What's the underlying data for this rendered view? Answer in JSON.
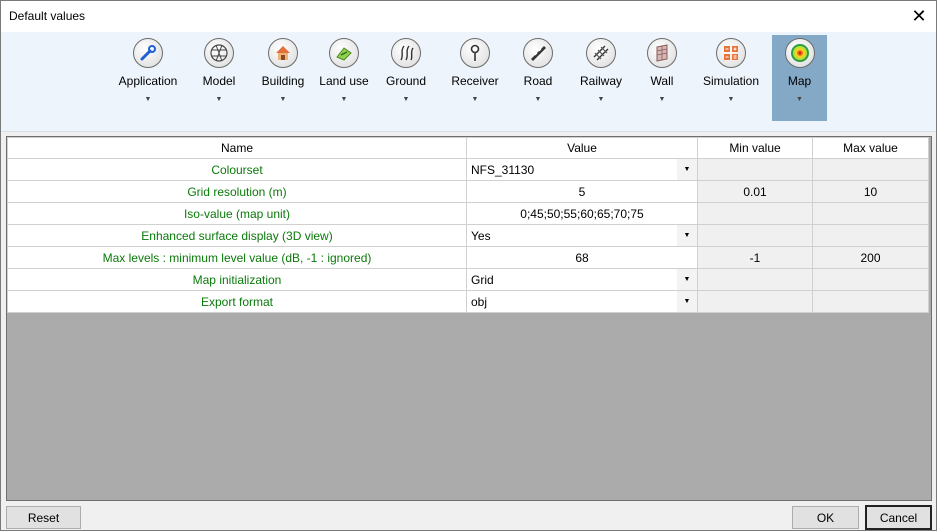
{
  "window": {
    "title": "Default values",
    "close_glyph": "✕"
  },
  "ribbon": {
    "tools": [
      {
        "label": "Application",
        "icon": "wrench-icon",
        "active": false
      },
      {
        "label": "Model",
        "icon": "mesh-icon",
        "active": false
      },
      {
        "label": "Building",
        "icon": "house-icon",
        "active": false
      },
      {
        "label": "Land use",
        "icon": "land-use-icon",
        "active": false
      },
      {
        "label": "Ground",
        "icon": "ground-icon",
        "active": false
      },
      {
        "label": "Receiver",
        "icon": "receiver-icon",
        "active": false
      },
      {
        "label": "Road",
        "icon": "road-icon",
        "active": false
      },
      {
        "label": "Railway",
        "icon": "railway-icon",
        "active": false
      },
      {
        "label": "Wall",
        "icon": "wall-icon",
        "active": false
      },
      {
        "label": "Simulation",
        "icon": "calculator-icon",
        "active": false
      },
      {
        "label": "Map",
        "icon": "map-icon",
        "active": true
      }
    ],
    "dropdown_glyph": "▼"
  },
  "table": {
    "headers": {
      "name": "Name",
      "value": "Value",
      "min": "Min value",
      "max": "Max value"
    },
    "rows": [
      {
        "name": "Colourset",
        "value": "NFS_31130",
        "combo": true,
        "min": "",
        "max": ""
      },
      {
        "name": "Grid resolution (m)",
        "value": "5",
        "combo": false,
        "min": "0.01",
        "max": "10"
      },
      {
        "name": "Iso-value (map unit)",
        "value": "0;45;50;55;60;65;70;75",
        "combo": false,
        "min": "",
        "max": ""
      },
      {
        "name": "Enhanced surface display (3D view)",
        "value": "Yes",
        "combo": true,
        "min": "",
        "max": ""
      },
      {
        "name": "Max levels : minimum level value (dB, -1 : ignored)",
        "value": "68",
        "combo": false,
        "min": "-1",
        "max": "200"
      },
      {
        "name": "Map initialization",
        "value": "Grid",
        "combo": true,
        "min": "",
        "max": ""
      },
      {
        "name": "Export format",
        "value": "obj",
        "combo": true,
        "min": "",
        "max": ""
      }
    ]
  },
  "buttons": {
    "reset": "Reset",
    "ok": "OK",
    "cancel": "Cancel"
  },
  "colors": {
    "name_text": "#0a7a0a",
    "active_tool": "#84a9c7",
    "ribbon_bg": "#eef4fc",
    "panel_bg": "#ababab"
  }
}
